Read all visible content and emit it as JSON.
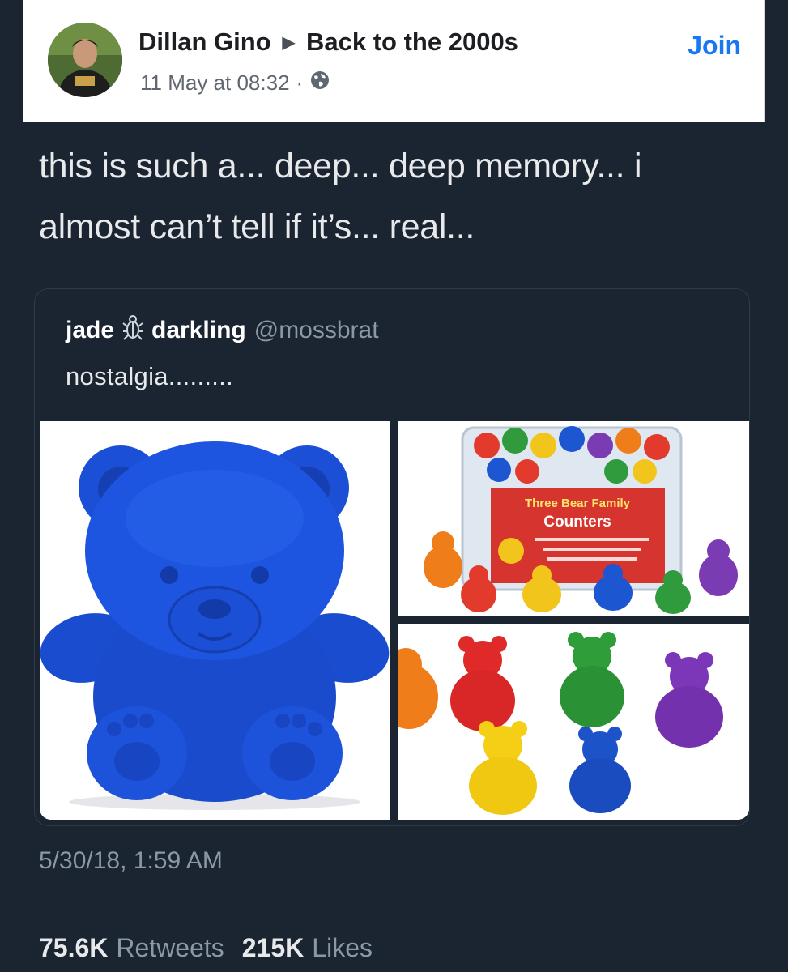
{
  "post_header": {
    "author": "Dillan Gino",
    "group": "Back to the 2000s",
    "timestamp": "11 May at 08:32",
    "separator": "·",
    "privacy_icon": "globe-icon",
    "join_label": "Join",
    "accent_color": "#1877f2"
  },
  "tweet": {
    "text_line1": "this is such a... deep... deep memory... i",
    "text_line2": "almost can’t tell if it’s... real...",
    "date": "5/30/18, 1:59 AM",
    "retweets_count": "75.6K",
    "retweets_label": "Retweets",
    "likes_count": "215K",
    "likes_label": "Likes"
  },
  "quoted_tweet": {
    "name_part1": "jade",
    "name_part2": "darkling",
    "emoji_icon": "beetle-icon",
    "handle": "@mossbrat",
    "text": "nostalgia.........",
    "jar_label_brand": "Three Bear Family",
    "jar_label_title": "Counters"
  },
  "theme": {
    "background": "#1b2431",
    "text": "#e7e9ea",
    "muted": "#8b98a5"
  }
}
